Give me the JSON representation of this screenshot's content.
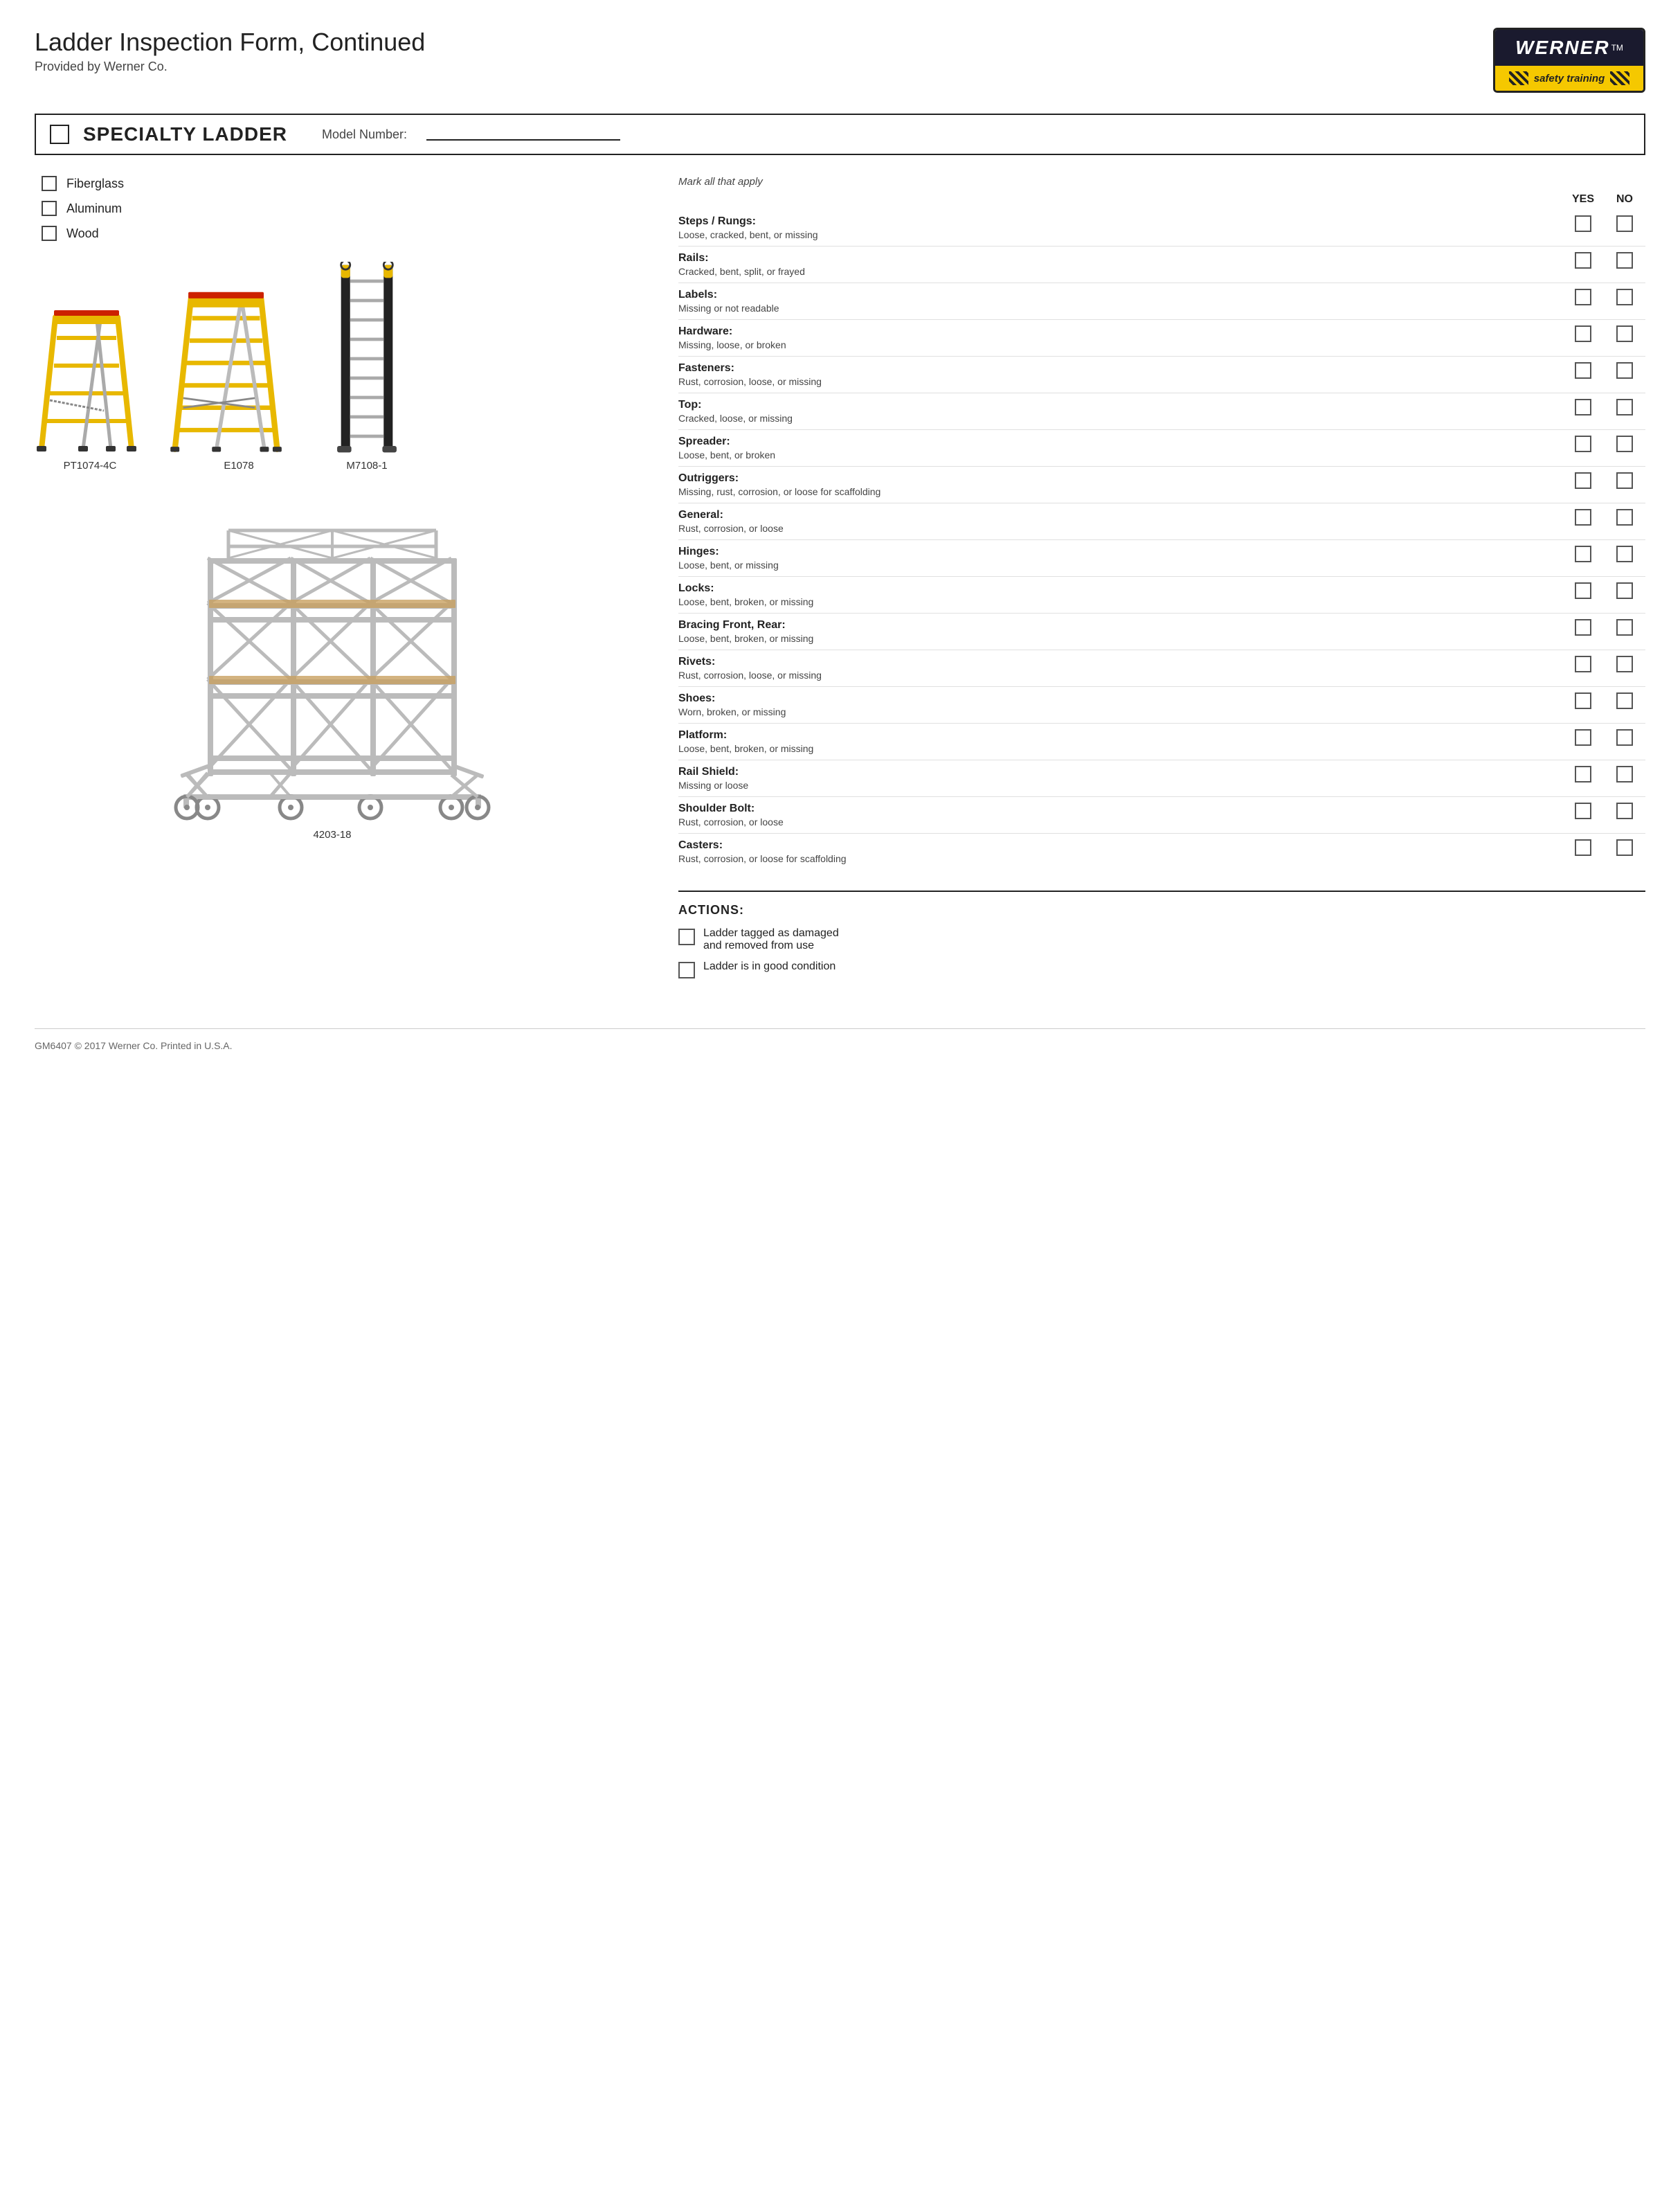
{
  "header": {
    "title": "Ladder Inspection Form, Continued",
    "subtitle": "Provided by Werner Co.",
    "logo": {
      "brand": "WERNER",
      "tm": "TM",
      "tagline": "safety training"
    }
  },
  "section": {
    "title": "SPECIALTY LADDER",
    "model_number_label": "Model Number:",
    "model_number_value": ""
  },
  "materials": [
    {
      "label": "Fiberglass"
    },
    {
      "label": "Aluminum"
    },
    {
      "label": "Wood"
    }
  ],
  "ladders": [
    {
      "model": "PT1074-4C",
      "type": "a-frame-small"
    },
    {
      "model": "E1078",
      "type": "a-frame-large"
    },
    {
      "model": "M7108-1",
      "type": "extension"
    }
  ],
  "scaffold": {
    "model": "4203-18"
  },
  "mark_all_label": "Mark all that apply",
  "yes_label": "YES",
  "no_label": "NO",
  "inspection_items": [
    {
      "label": "Steps / Rungs:",
      "desc": "Loose, cracked, bent, or missing"
    },
    {
      "label": "Rails:",
      "desc": "Cracked, bent, split, or frayed"
    },
    {
      "label": "Labels:",
      "desc": "Missing or not readable"
    },
    {
      "label": "Hardware:",
      "desc": "Missing, loose, or broken"
    },
    {
      "label": "Fasteners:",
      "desc": "Rust, corrosion, loose, or missing"
    },
    {
      "label": "Top:",
      "desc": "Cracked, loose, or missing"
    },
    {
      "label": "Spreader:",
      "desc": "Loose, bent, or broken"
    },
    {
      "label": "Outriggers:",
      "desc": "Missing, rust, corrosion, or loose for scaffolding"
    },
    {
      "label": "General:",
      "desc": "Rust, corrosion, or loose"
    },
    {
      "label": "Hinges:",
      "desc": "Loose, bent, or missing"
    },
    {
      "label": "Locks:",
      "desc": "Loose, bent, broken, or missing"
    },
    {
      "label": "Bracing Front, Rear:",
      "desc": "Loose, bent, broken, or missing"
    },
    {
      "label": "Rivets:",
      "desc": "Rust, corrosion, loose, or missing"
    },
    {
      "label": "Shoes:",
      "desc": "Worn, broken, or missing"
    },
    {
      "label": "Platform:",
      "desc": "Loose, bent, broken, or missing"
    },
    {
      "label": "Rail Shield:",
      "desc": "Missing or loose"
    },
    {
      "label": "Shoulder Bolt:",
      "desc": "Rust, corrosion, or loose"
    },
    {
      "label": "Casters:",
      "desc": "Rust, corrosion, or loose for scaffolding"
    }
  ],
  "actions": {
    "title": "ACTIONS:",
    "items": [
      {
        "text": "Ladder tagged as damaged\nand removed from use"
      },
      {
        "text": "Ladder is in good condition"
      }
    ]
  },
  "footer": {
    "text": "GM6407 © 2017 Werner Co. Printed in U.S.A."
  }
}
